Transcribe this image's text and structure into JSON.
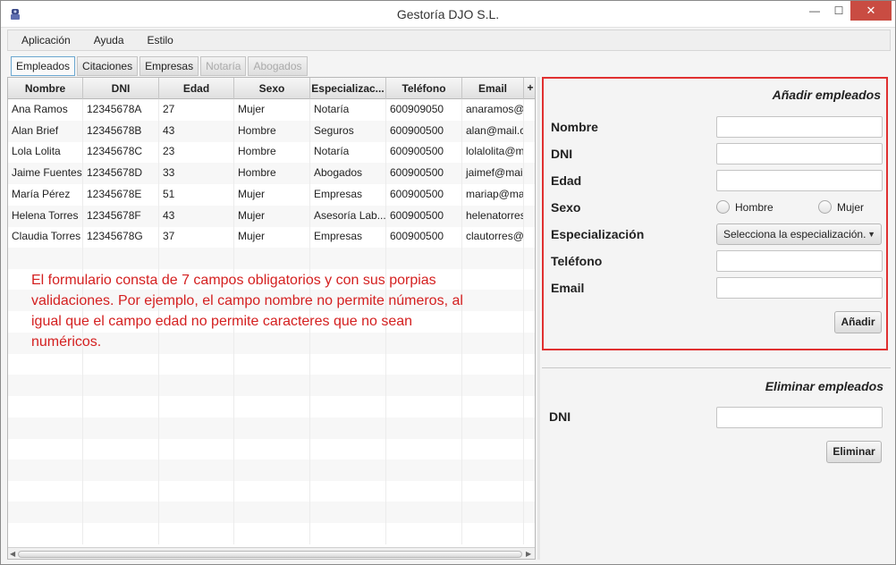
{
  "window": {
    "title": "Gestoría DJO S.L."
  },
  "menu": [
    "Aplicación",
    "Ayuda",
    "Estilo"
  ],
  "tabs": [
    {
      "label": "Empleados",
      "state": "active"
    },
    {
      "label": "Citaciones",
      "state": "normal"
    },
    {
      "label": "Empresas",
      "state": "normal"
    },
    {
      "label": "Notaría",
      "state": "disabled"
    },
    {
      "label": "Abogados",
      "state": "disabled"
    }
  ],
  "table": {
    "columns": [
      "Nombre",
      "DNI",
      "Edad",
      "Sexo",
      "Especializac...",
      "Teléfono",
      "Email"
    ],
    "add_column": "+",
    "rows": [
      [
        "Ana Ramos",
        "12345678A",
        "27",
        "Mujer",
        "Notaría",
        "600909050",
        "anaramos@..."
      ],
      [
        "Alan Brief",
        "12345678B",
        "43",
        "Hombre",
        "Seguros",
        "600900500",
        "alan@mail.c..."
      ],
      [
        "Lola Lolita",
        "12345678C",
        "23",
        "Hombre",
        "Notaría",
        "600900500",
        "lolalolita@m..."
      ],
      [
        "Jaime Fuentes",
        "12345678D",
        "33",
        "Hombre",
        "Abogados",
        "600900500",
        "jaimef@mail...."
      ],
      [
        "María Pérez",
        "12345678E",
        "51",
        "Mujer",
        "Empresas",
        "600900500",
        "mariap@mai..."
      ],
      [
        "Helena Torres",
        "12345678F",
        "43",
        "Mujer",
        "Asesoría Lab...",
        "600900500",
        "helenatorres..."
      ],
      [
        "Claudia Torres",
        "12345678G",
        "37",
        "Mujer",
        "Empresas",
        "600900500",
        "clautorres@..."
      ]
    ]
  },
  "annotation": "El formulario consta de 7 campos obligatorios y con sus porpias validaciones. Por ejemplo, el campo nombre no permite números, al igual que el campo edad no permite caracteres que no sean numéricos.",
  "add_form": {
    "title": "Añadir empleados",
    "labels": {
      "nombre": "Nombre",
      "dni": "DNI",
      "edad": "Edad",
      "sexo": "Sexo",
      "especializacion": "Especialización",
      "telefono": "Teléfono",
      "email": "Email"
    },
    "sexo_options": [
      "Hombre",
      "Mujer"
    ],
    "especializacion_placeholder": "Selecciona la especialización.",
    "submit_label": "Añadir",
    "highlight_color": "#e03030"
  },
  "delete_form": {
    "title": "Eliminar empleados",
    "dni_label": "DNI",
    "submit_label": "Eliminar"
  }
}
